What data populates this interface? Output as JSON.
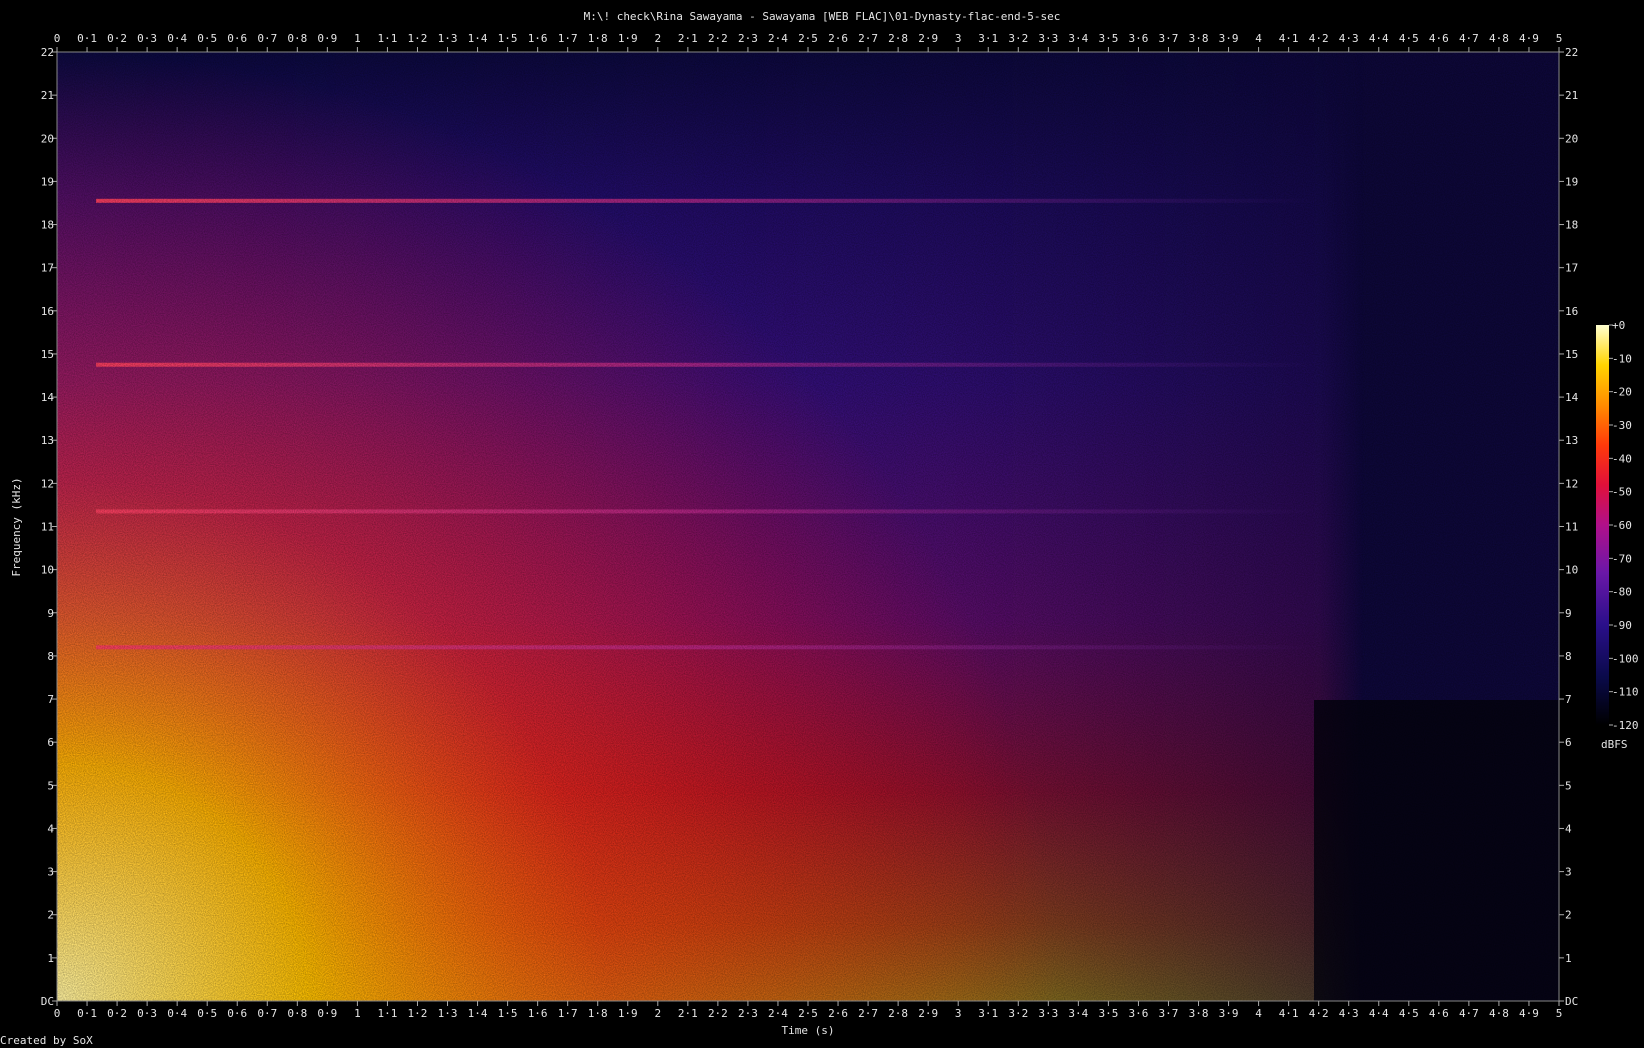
{
  "chart_data": {
    "type": "heatmap",
    "title": "M:\\! check\\Rina Sawayama - Sawayama [WEB FLAC]\\01-Dynasty-flac-end-5-sec",
    "xlabel": "Time (s)",
    "ylabel": "Frequency (kHz)",
    "xlim": [
      0,
      5
    ],
    "ylim": [
      0,
      22
    ],
    "x_ticks": [
      "0",
      "0·1",
      "0·2",
      "0·3",
      "0·4",
      "0·5",
      "0·6",
      "0·7",
      "0·8",
      "0·9",
      "1",
      "1·1",
      "1·2",
      "1·3",
      "1·4",
      "1·5",
      "1·6",
      "1·7",
      "1·8",
      "1·9",
      "2",
      "2·1",
      "2·2",
      "2·3",
      "2·4",
      "2·5",
      "2·6",
      "2·7",
      "2·8",
      "2·9",
      "3",
      "3·1",
      "3·2",
      "3·3",
      "3·4",
      "3·5",
      "3·6",
      "3·7",
      "3·8",
      "3·9",
      "4",
      "4·1",
      "4·2",
      "4·3",
      "4·4",
      "4·5",
      "4·6",
      "4·7",
      "4·8",
      "4·9",
      "5"
    ],
    "y_ticks": [
      "DC",
      "1",
      "2",
      "3",
      "4",
      "5",
      "6",
      "7",
      "8",
      "9",
      "10",
      "11",
      "12",
      "13",
      "14",
      "15",
      "16",
      "17",
      "18",
      "19",
      "20",
      "21",
      "22"
    ],
    "colorbar": {
      "label": "dBFS",
      "ticks": [
        "+0",
        "-10",
        "-20",
        "-30",
        "-40",
        "-50",
        "-60",
        "-70",
        "-80",
        "-90",
        "-100",
        "-110",
        "-120"
      ],
      "range": [
        -120,
        0
      ]
    },
    "tonal_lines_khz": [
      8.2,
      11.35,
      14.75,
      18.55
    ],
    "decay_end_s": 4.2,
    "grid": false
  },
  "footer": "Created by SoX",
  "colors": {
    "background": "#000000",
    "text": "#e6e6e6",
    "gradient": [
      "#000000",
      "#0a0a4a",
      "#2a0f8a",
      "#6a17a8",
      "#b0108a",
      "#e0103a",
      "#ff3a0a",
      "#ff8c00",
      "#ffd400",
      "#ffffd0"
    ]
  }
}
